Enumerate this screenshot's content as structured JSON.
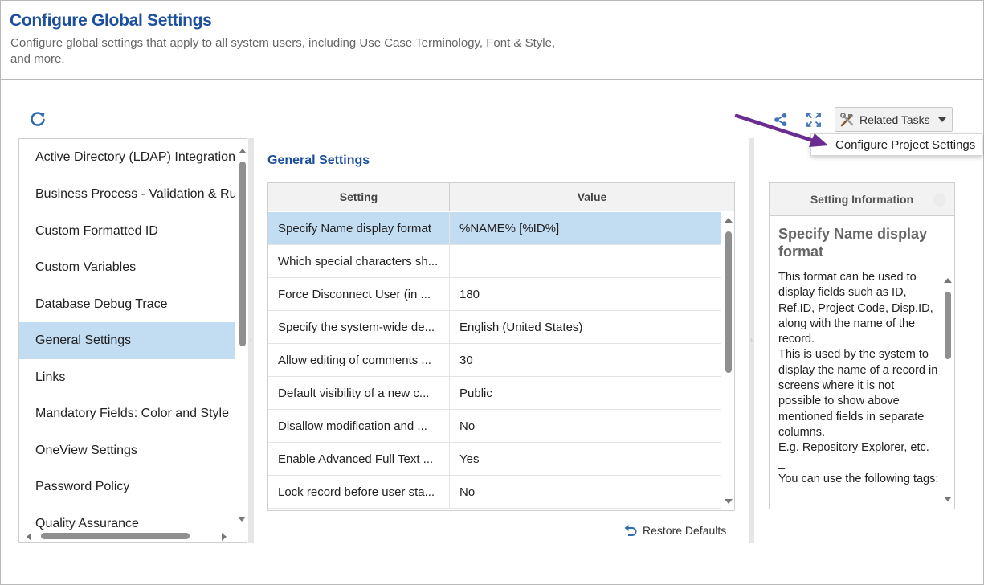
{
  "header": {
    "title": "Configure Global Settings",
    "description": "Configure global settings that apply to all system users, including Use Case Terminology, Font & Style, and more."
  },
  "toolbar": {
    "refresh_icon": "refresh-icon",
    "share_icon": "share-icon",
    "expand_icon": "expand-icon",
    "related_tasks_label": "Related Tasks",
    "related_tasks_icon": "tools-icon",
    "dropdown_item": "Configure Project Settings"
  },
  "sidebar": {
    "items": [
      {
        "label": "Active Directory (LDAP) Integration"
      },
      {
        "label": "Business Process - Validation & Rules"
      },
      {
        "label": "Custom Formatted ID"
      },
      {
        "label": "Custom Variables"
      },
      {
        "label": "Database Debug Trace"
      },
      {
        "label": "General Settings",
        "active": true
      },
      {
        "label": "Links"
      },
      {
        "label": "Mandatory Fields: Color and Style"
      },
      {
        "label": "OneView Settings"
      },
      {
        "label": "Password Policy"
      },
      {
        "label": "Quality Assurance"
      }
    ]
  },
  "main": {
    "section_title": "General Settings",
    "columns": {
      "setting": "Setting",
      "value": "Value"
    },
    "rows": [
      {
        "setting": "Specify Name display format",
        "value": "%NAME% [%ID%]",
        "selected": true
      },
      {
        "setting": "Which special characters sh...",
        "value": ""
      },
      {
        "setting": "Force Disconnect User (in ...",
        "value": "180"
      },
      {
        "setting": "Specify the system-wide de...",
        "value": "English (United States)"
      },
      {
        "setting": "Allow editing of comments ...",
        "value": "30"
      },
      {
        "setting": "Default visibility of a new c...",
        "value": "Public"
      },
      {
        "setting": "Disallow modification and ...",
        "value": "No"
      },
      {
        "setting": "Enable Advanced Full Text ...",
        "value": "Yes"
      },
      {
        "setting": "Lock record before user sta...",
        "value": "No"
      }
    ],
    "restore_label": "Restore Defaults"
  },
  "info": {
    "header": "Setting Information",
    "title": "Specify Name display format",
    "paragraphs": [
      "This format can be used to display fields such as ID, Ref.ID, Project Code, Disp.ID, along with the name of the record.",
      "This is used by the system to display the name of a record in screens where it is not possible to show above mentioned fields in separate columns.",
      "E.g. Repository Explorer, etc.",
      "_",
      "You can use the following tags:"
    ]
  },
  "colors": {
    "accent": "#1d4fa0",
    "selection": "#c2dcf2",
    "annotation_arrow": "#6a2c91"
  }
}
